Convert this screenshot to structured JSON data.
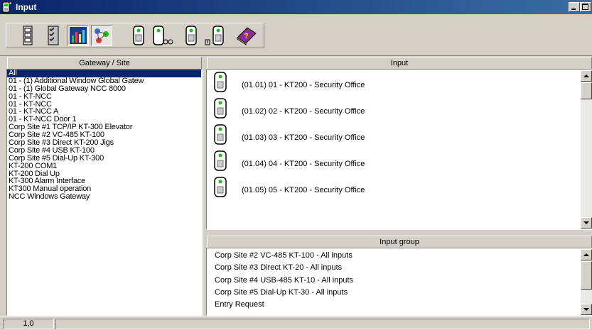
{
  "window": {
    "title": "Input"
  },
  "toolbar": {
    "buttons": [
      {
        "icon": "cabinet-icon"
      },
      {
        "icon": "checklist-icon"
      },
      {
        "icon": "chart-icon"
      },
      {
        "icon": "network-nodes-icon"
      },
      {
        "icon": "input-device-icon"
      },
      {
        "icon": "input-link-icon"
      },
      {
        "icon": "input-icon"
      },
      {
        "icon": "input-group-icon"
      },
      {
        "icon": "help-book-icon"
      }
    ]
  },
  "sites_panel": {
    "header": "Gateway / Site",
    "items": [
      "All",
      "01 - (1) Additional Window Global Gatew",
      "01 - (1) Global Gateway NCC 8000",
      "01 - KT-NCC",
      "01 - KT-NCC",
      "01 - KT-NCC A",
      "01 - KT-NCC Door 1",
      "Corp Site #1 TCP/IP KT-300 Elevator",
      "Corp Site #2 VC-485 KT-100",
      "Corp Site #3  Direct KT-200 Jigs",
      "Corp Site #4 USB KT-100",
      "Corp Site #5 Dial-Up KT-300",
      "KT-200  COM1",
      "KT-200 Dial Up",
      "KT-300 Alarm Interface",
      "KT300 Manual operation",
      "NCC Windows Gateway"
    ],
    "selected_index": 0
  },
  "input_panel": {
    "header": "Input",
    "items": [
      "(01.01) 01 - KT200 - Security Office",
      "(01.02) 02 - KT200 - Security Office",
      "(01.03) 03 - KT200 - Security Office",
      "(01.04) 04 - KT200 - Security Office",
      "(01.05) 05 - KT200 - Security Office"
    ]
  },
  "group_panel": {
    "header": "Input group",
    "items": [
      "Corp Site #2 VC-485 KT-100 - All inputs",
      "Corp Site #3  Direct KT-20 - All inputs",
      "Corp Site #4 USB-485 KT-10 - All inputs",
      "Corp Site #5 Dial-Up KT-30 - All inputs",
      "Entry Request"
    ]
  },
  "status": {
    "position": "1,0"
  },
  "colors": {
    "titlebar": "#0a246a",
    "selection": "#0a246a",
    "chrome": "#d4d0c8"
  }
}
